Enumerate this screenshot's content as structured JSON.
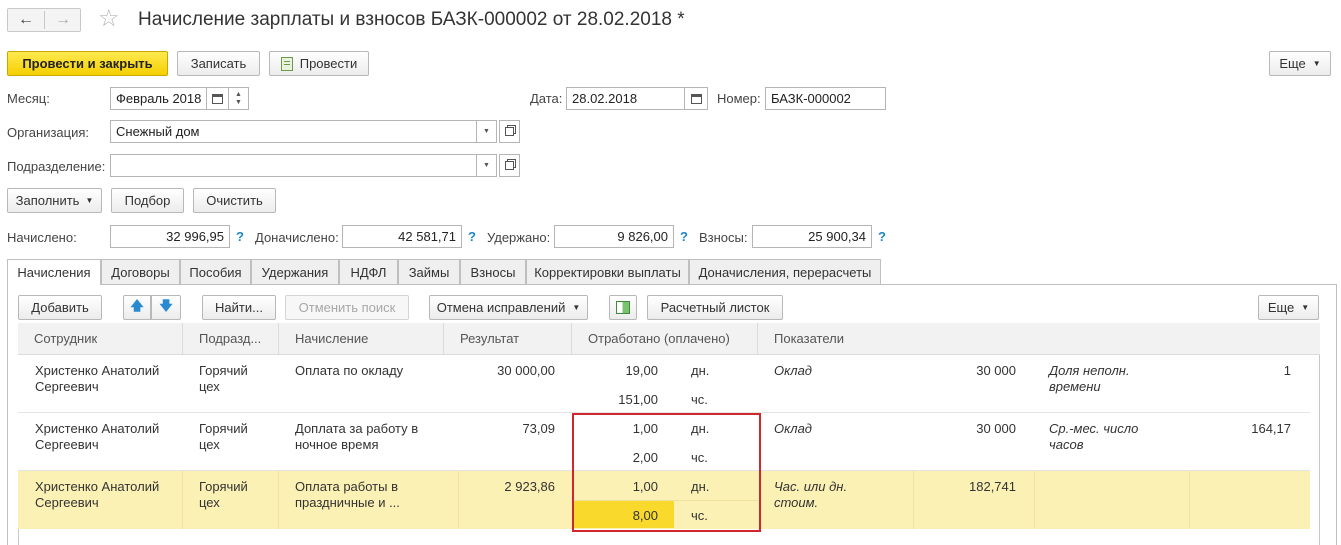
{
  "window": {
    "title": "Начисление зарплаты и взносов БАЗК-000002 от 28.02.2018 *",
    "back_icon": "←",
    "forward_icon": "→",
    "star_icon": "☆"
  },
  "toolbar": {
    "post_close": "Провести и закрыть",
    "save": "Записать",
    "post": "Провести",
    "more": "Еще"
  },
  "form": {
    "month_label": "Месяц:",
    "month_value": "Февраль 2018",
    "date_label": "Дата:",
    "date_value": "28.02.2018",
    "number_label": "Номер:",
    "number_value": "БАЗК-000002",
    "org_label": "Организация:",
    "org_value": "Снежный дом",
    "dept_label": "Подразделение:",
    "dept_value": ""
  },
  "actions": {
    "fill": "Заполнить",
    "select": "Подбор",
    "clear": "Очистить"
  },
  "totals": {
    "accrued_label": "Начислено:",
    "accrued_value": "32 996,95",
    "additional_label": "Доначислено:",
    "additional_value": "42 581,71",
    "withheld_label": "Удержано:",
    "withheld_value": "9 826,00",
    "contrib_label": "Взносы:",
    "contrib_value": "25 900,34",
    "help": "?"
  },
  "tabs": [
    "Начисления",
    "Договоры",
    "Пособия",
    "Удержания",
    "НДФЛ",
    "Займы",
    "Взносы",
    "Корректировки выплаты",
    "Доначисления, перерасчеты"
  ],
  "grid_toolbar": {
    "add": "Добавить",
    "find": "Найти...",
    "cancel_search": "Отменить поиск",
    "corrections": "Отмена исправлений",
    "payslip": "Расчетный листок",
    "more": "Еще"
  },
  "columns": {
    "employee": "Сотрудник",
    "dept": "Подразд...",
    "accrual": "Начисление",
    "result": "Результат",
    "worked": "Отработано (оплачено)",
    "indicators": "Показатели"
  },
  "rows": [
    {
      "employee": "Христенко Анатолий Сергеевич",
      "dept": "Горячий цех",
      "accrual": "Оплата по окладу",
      "result": "30 000,00",
      "days": "19,00",
      "days_unit": "дн.",
      "hours": "151,00",
      "hours_unit": "чс.",
      "ind1_name": "Оклад",
      "ind1_value": "30 000",
      "ind2_name": "Доля неполн. времени",
      "ind2_value": "1"
    },
    {
      "employee": "Христенко Анатолий Сергеевич",
      "dept": "Горячий цех",
      "accrual": "Доплата за работу в ночное время",
      "result": "73,09",
      "days": "1,00",
      "days_unit": "дн.",
      "hours": "2,00",
      "hours_unit": "чс.",
      "ind1_name": "Оклад",
      "ind1_value": "30 000",
      "ind2_name": "Ср.-мес. число часов",
      "ind2_value": "164,17"
    },
    {
      "employee": "Христенко Анатолий Сергеевич",
      "dept": "Горячий цех",
      "accrual": "Оплата работы в праздничные и ...",
      "result": "2 923,86",
      "days": "1,00",
      "days_unit": "дн.",
      "hours": "8,00",
      "hours_unit": "чс.",
      "ind1_name": "Час. или дн. стоим.",
      "ind1_value": "182,741",
      "ind2_name": "",
      "ind2_value": ""
    }
  ],
  "colors": {
    "primary_button": "#f5cf00",
    "selected_row": "#fbf1b4",
    "active_cell": "#f9da2c",
    "highlight_frame": "#d0262e",
    "help_icon": "#1f86c8"
  }
}
